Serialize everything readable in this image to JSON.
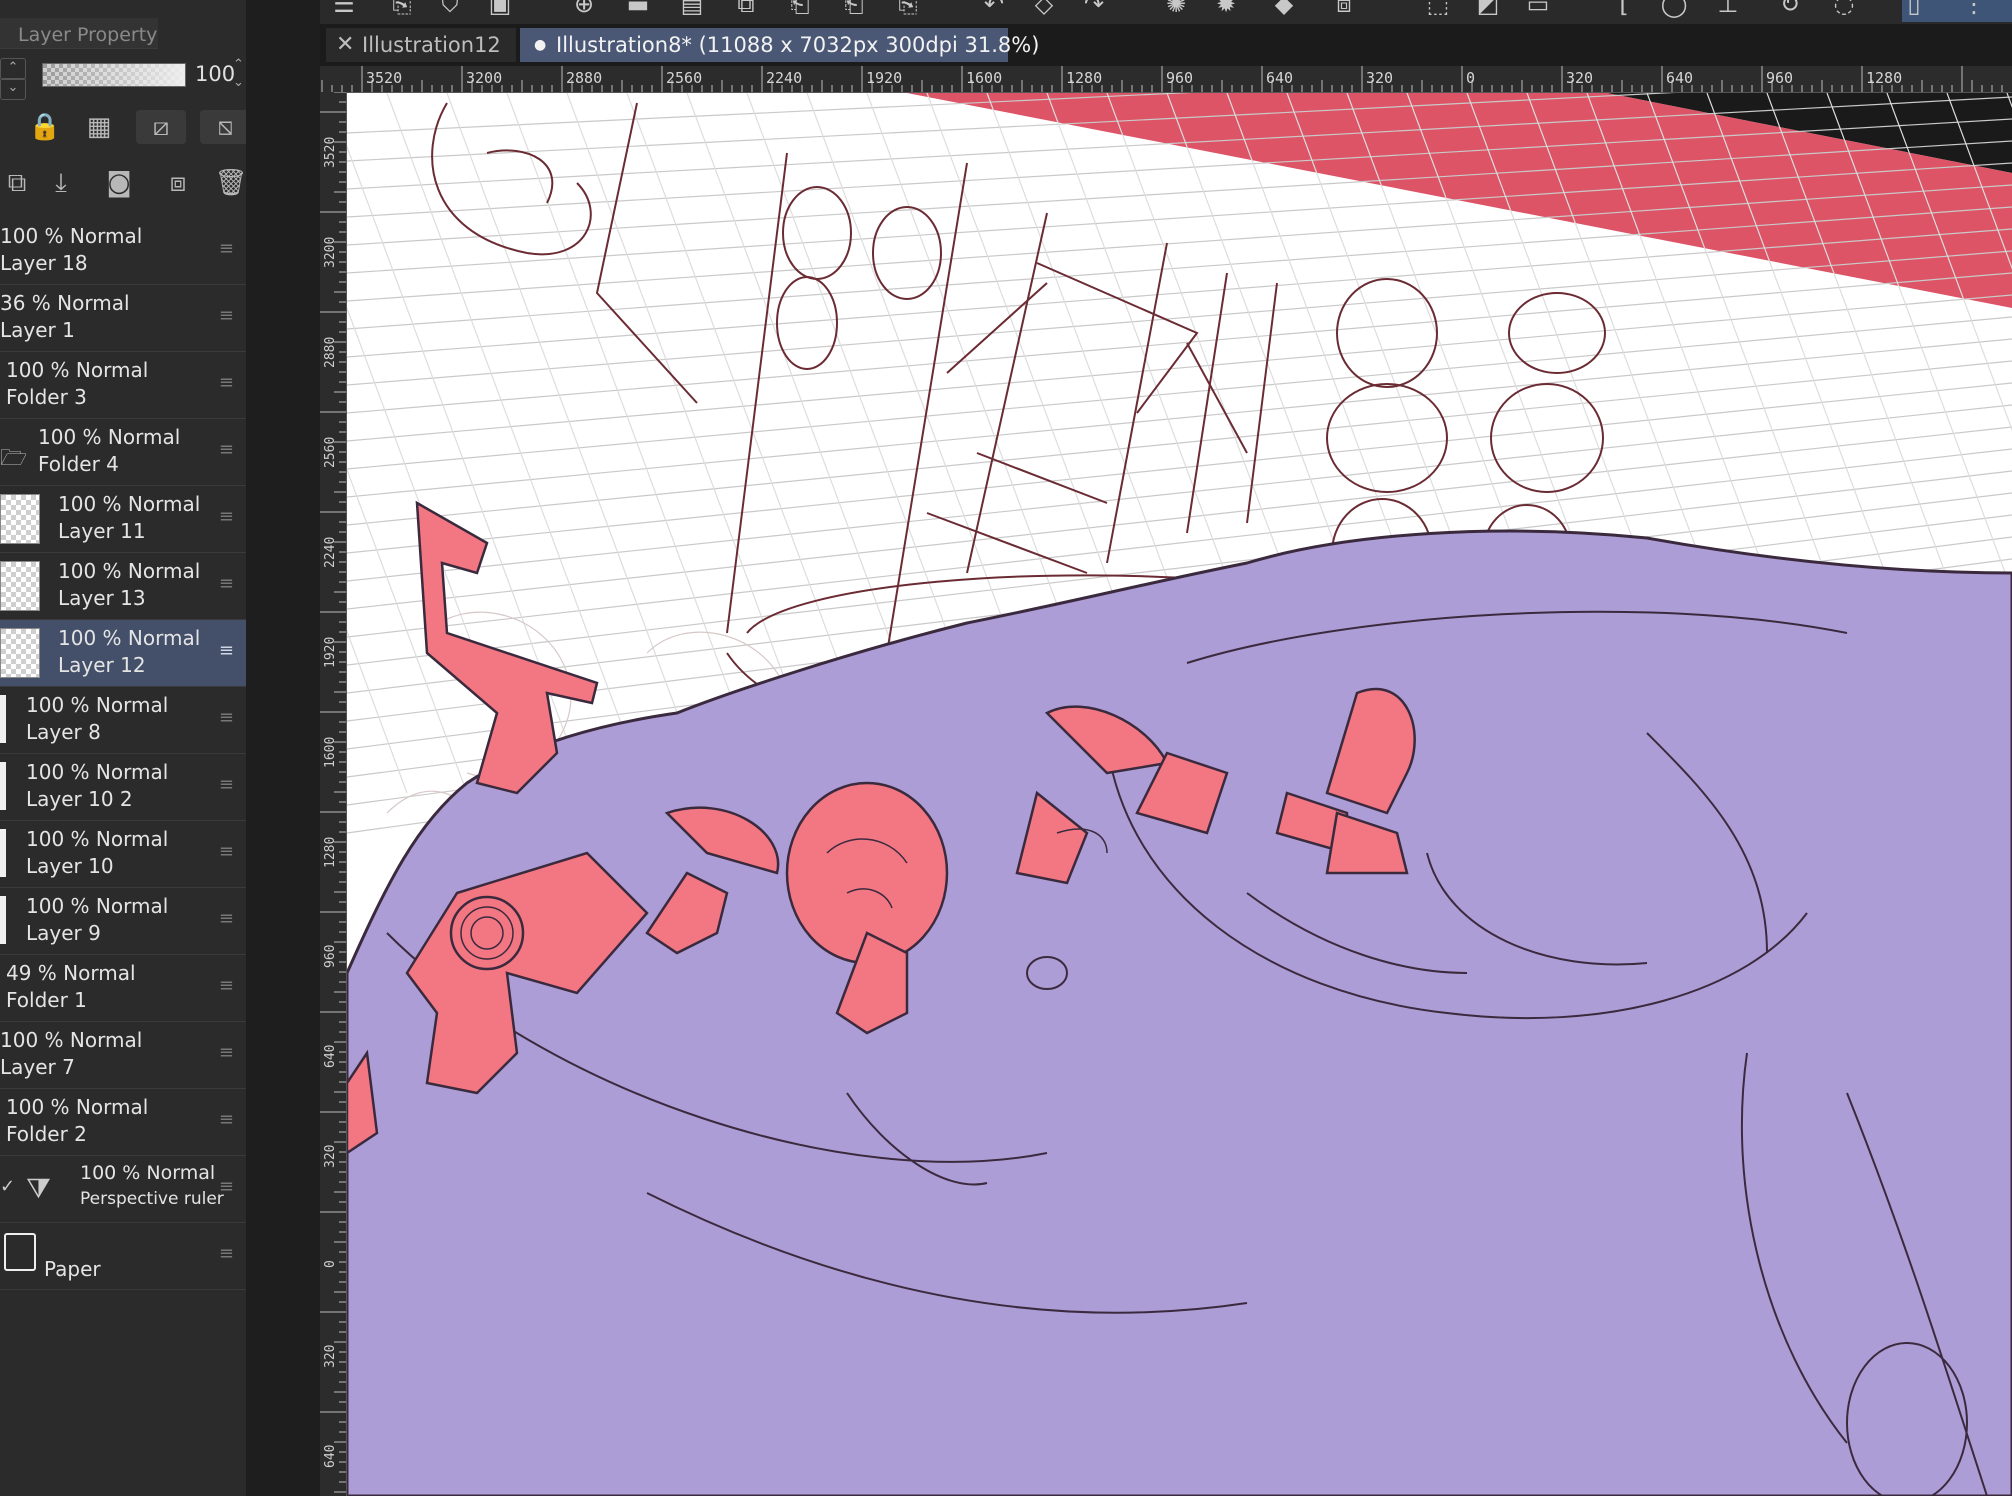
{
  "panel": {
    "header_title": "Layer Property",
    "opacity_value": "100",
    "layers": [
      {
        "opacity_mode": "100 % Normal",
        "name": "Layer 18",
        "kind": "layer",
        "selected": false
      },
      {
        "opacity_mode": "36 % Normal",
        "name": "Layer 1",
        "kind": "layer",
        "selected": false
      },
      {
        "opacity_mode": "100 % Normal",
        "name": "Folder 3",
        "kind": "folder",
        "selected": false
      },
      {
        "opacity_mode": "100 % Normal",
        "name": "Folder 4",
        "kind": "folder",
        "selected": false
      },
      {
        "opacity_mode": "100 % Normal",
        "name": "Layer 11",
        "kind": "layer",
        "selected": false
      },
      {
        "opacity_mode": "100 % Normal",
        "name": "Layer 13",
        "kind": "layer",
        "selected": false
      },
      {
        "opacity_mode": "100 % Normal",
        "name": "Layer 12",
        "kind": "layer",
        "selected": true
      },
      {
        "opacity_mode": "100 % Normal",
        "name": "Layer 8",
        "kind": "layer",
        "selected": false
      },
      {
        "opacity_mode": "100 % Normal",
        "name": "Layer 10 2",
        "kind": "layer",
        "selected": false
      },
      {
        "opacity_mode": "100 % Normal",
        "name": "Layer 10",
        "kind": "layer",
        "selected": false
      },
      {
        "opacity_mode": "100 % Normal",
        "name": "Layer 9",
        "kind": "layer",
        "selected": false
      },
      {
        "opacity_mode": "49 % Normal",
        "name": "Folder 1",
        "kind": "folder",
        "selected": false
      },
      {
        "opacity_mode": "100 % Normal",
        "name": "Layer 7",
        "kind": "layer",
        "selected": false
      },
      {
        "opacity_mode": "100 % Normal",
        "name": "Folder 2",
        "kind": "folder",
        "selected": false
      },
      {
        "opacity_mode": "100 % Normal",
        "name": "Perspective ruler",
        "kind": "ruler",
        "selected": false
      },
      {
        "opacity_mode": "",
        "name": "Paper",
        "kind": "paper",
        "selected": false
      }
    ]
  },
  "tabs": [
    {
      "label": "Illustration12",
      "active": false
    },
    {
      "label": "Illustration8* (11088 x 7032px 300dpi 31.8%)",
      "active": true
    }
  ],
  "ruler_top_labels": [
    "3520",
    "3200",
    "2880",
    "2560",
    "2240",
    "1920",
    "1600",
    "1280",
    "960",
    "640",
    "320",
    "0",
    "320",
    "640",
    "960",
    "1280"
  ],
  "ruler_left_labels": [
    "3520",
    "3200",
    "2880",
    "2560",
    "2240",
    "1920",
    "1600",
    "1280",
    "960",
    "640",
    "320",
    "0",
    "320",
    "640"
  ],
  "colors": {
    "fill_purple": "#ad9dd6",
    "fill_pink": "#f27782",
    "accent_red": "#dd5466",
    "line_brown": "#6b2b33",
    "grid_gray": "#c9c9c9",
    "selected_row": "#44506a"
  }
}
